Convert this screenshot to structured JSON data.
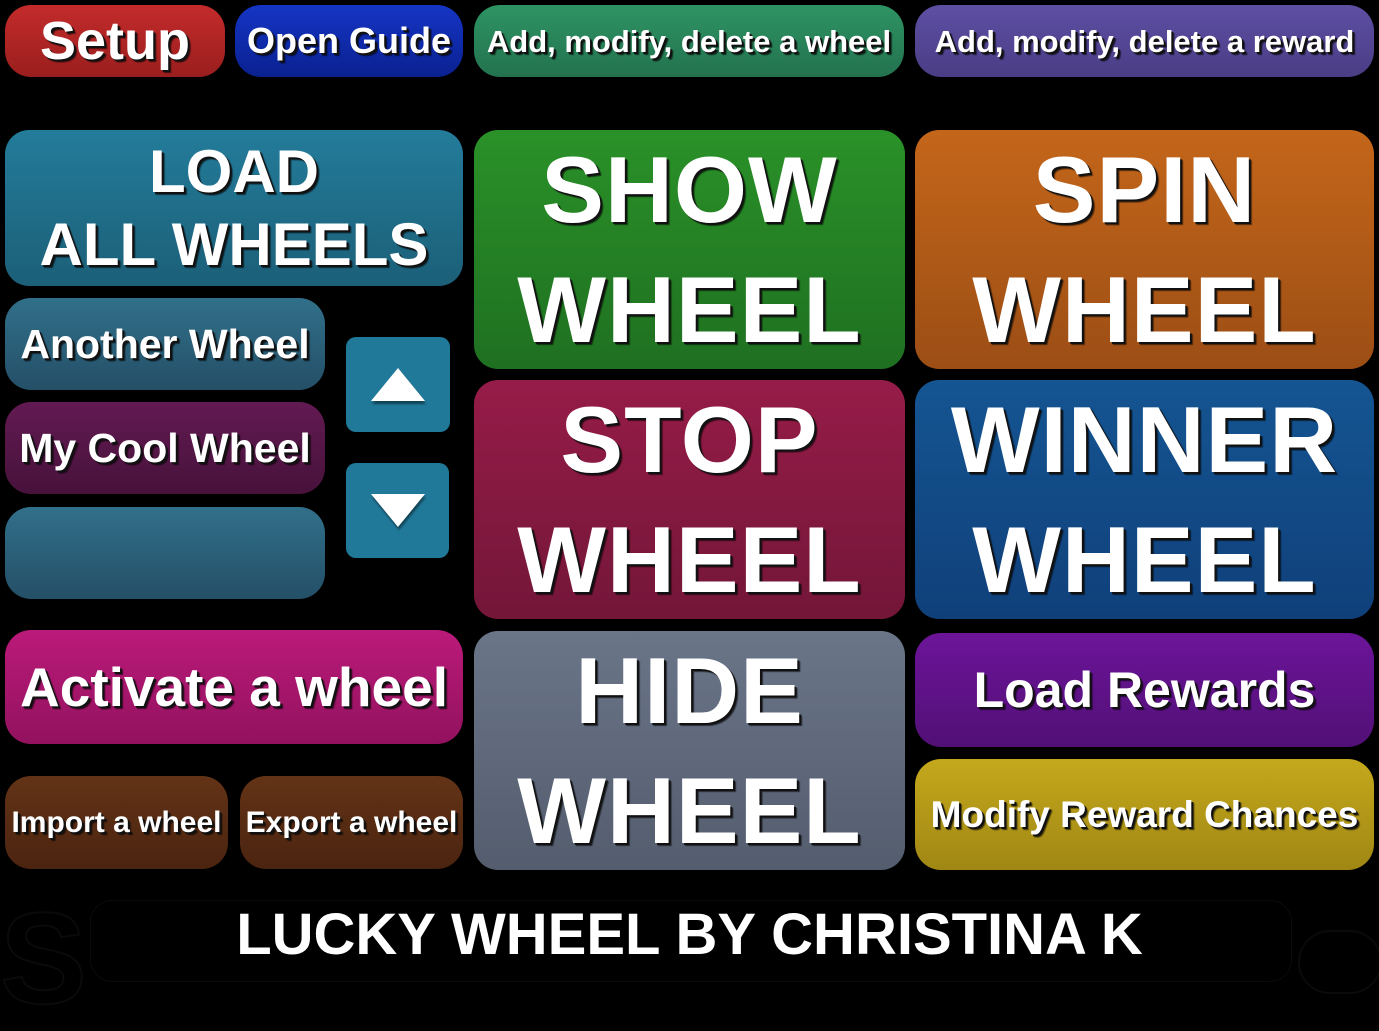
{
  "toolbar": {
    "setup_label": "Setup",
    "open_guide_label": "Open Guide",
    "edit_wheel_label": "Add, modify, delete a wheel",
    "edit_reward_label": "Add, modify, delete a reward"
  },
  "wheels": {
    "load_all_line1": "LOAD",
    "load_all_line2": "ALL WHEELS",
    "list": [
      {
        "label": "Another Wheel",
        "color": "#2b6580"
      },
      {
        "label": "My Cool Wheel",
        "color": "#561747"
      },
      {
        "label": "",
        "color": "#2b6580"
      }
    ],
    "scroll_up_icon": "triangle-up-icon",
    "scroll_down_icon": "triangle-down-icon",
    "activate_label": "Activate a wheel",
    "import_label": "Import a wheel",
    "export_label": "Export a wheel"
  },
  "controls": {
    "show": {
      "line1": "SHOW",
      "line2": "WHEEL",
      "color": "#258027"
    },
    "spin": {
      "line1": "SPIN",
      "line2": "WHEEL",
      "color": "#b25c18"
    },
    "stop": {
      "line1": "STOP",
      "line2": "WHEEL",
      "color": "#861a42"
    },
    "winner": {
      "line1": "WINNER",
      "line2": "WHEEL",
      "color": "#124a86"
    },
    "hide": {
      "line1": "HIDE",
      "line2": "WHEEL",
      "color": "#5f697b"
    }
  },
  "rewards": {
    "load_label": "Load Rewards",
    "modify_chances_label": "Modify Reward Chances"
  },
  "footer": {
    "credit": "LUCKY WHEEL BY CHRISTINA K"
  }
}
